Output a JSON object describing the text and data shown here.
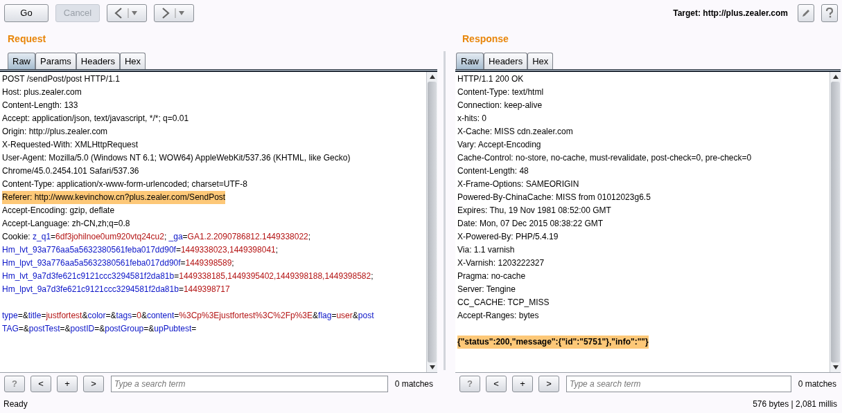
{
  "toolbar": {
    "buttons": [
      {
        "label": "Go",
        "disabled": false
      },
      {
        "label": "Cancel",
        "disabled": true
      }
    ],
    "target_label": "Target: http://plus.zealer.com"
  },
  "panes": [
    {
      "title": "Request",
      "tabs": [
        {
          "label": "Raw",
          "selected": true
        },
        {
          "label": "Params",
          "selected": false
        },
        {
          "label": "Headers",
          "selected": false
        },
        {
          "label": "Hex",
          "selected": false
        }
      ],
      "lines": [
        {
          "segments": [
            {
              "kind": "plain",
              "text": "POST /sendPost/post HTTP/1.1"
            }
          ]
        },
        {
          "segments": [
            {
              "kind": "plain",
              "text": "Host: plus.zealer.com"
            }
          ]
        },
        {
          "segments": [
            {
              "kind": "plain",
              "text": "Content-Length: 133"
            }
          ]
        },
        {
          "segments": [
            {
              "kind": "plain",
              "text": "Accept: application/json, text/javascript, */*; q=0.01"
            }
          ]
        },
        {
          "segments": [
            {
              "kind": "plain",
              "text": "Origin: http://plus.zealer.com"
            }
          ]
        },
        {
          "segments": [
            {
              "kind": "plain",
              "text": "X-Requested-With: XMLHttpRequest"
            }
          ]
        },
        {
          "segments": [
            {
              "kind": "plain",
              "text": "User-Agent: Mozilla/5.0 (Windows NT 6.1; WOW64) AppleWebKit/537.36 (KHTML, like Gecko)"
            }
          ]
        },
        {
          "segments": [
            {
              "kind": "plain",
              "text": "Chrome/45.0.2454.101 Safari/537.36"
            }
          ]
        },
        {
          "segments": [
            {
              "kind": "plain",
              "text": "Content-Type: application/x-www-form-urlencoded; charset=UTF-8"
            }
          ]
        },
        {
          "highlighted": true,
          "segments": [
            {
              "kind": "plain",
              "text": "Referer: http://www.kevinchow.cn?plus.zealer.com/SendPost"
            }
          ]
        },
        {
          "segments": [
            {
              "kind": "plain",
              "text": "Accept-Encoding: gzip, deflate"
            }
          ]
        },
        {
          "segments": [
            {
              "kind": "plain",
              "text": "Accept-Language: zh-CN,zh;q=0.8"
            }
          ]
        },
        {
          "segments": [
            {
              "kind": "plain",
              "text": "Cookie: "
            },
            {
              "kind": "name",
              "text": "z_q1"
            },
            {
              "kind": "plain",
              "text": "="
            },
            {
              "kind": "value",
              "text": "6df3johilnoe0um920vtq24cu2"
            },
            {
              "kind": "plain",
              "text": "; "
            },
            {
              "kind": "name",
              "text": "_ga"
            },
            {
              "kind": "plain",
              "text": "="
            },
            {
              "kind": "value",
              "text": "GA1.2.2090786812.1449338022"
            },
            {
              "kind": "plain",
              "text": ";"
            }
          ]
        },
        {
          "segments": [
            {
              "kind": "name",
              "text": "Hm_lvt_93a776aa5a5632380561feba017dd90f"
            },
            {
              "kind": "plain",
              "text": "="
            },
            {
              "kind": "value",
              "text": "1449338023,1449398041"
            },
            {
              "kind": "plain",
              "text": ";"
            }
          ]
        },
        {
          "segments": [
            {
              "kind": "name",
              "text": "Hm_lpvt_93a776aa5a5632380561feba017dd90f"
            },
            {
              "kind": "plain",
              "text": "="
            },
            {
              "kind": "value",
              "text": "1449398589"
            },
            {
              "kind": "plain",
              "text": ";"
            }
          ]
        },
        {
          "segments": [
            {
              "kind": "name",
              "text": "Hm_lvt_9a7d3fe621c9121ccc3294581f2da81b"
            },
            {
              "kind": "plain",
              "text": "="
            },
            {
              "kind": "value",
              "text": "1449338185,1449395402,1449398188,1449398582"
            },
            {
              "kind": "plain",
              "text": ";"
            }
          ]
        },
        {
          "segments": [
            {
              "kind": "name",
              "text": "Hm_lpvt_9a7d3fe621c9121ccc3294581f2da81b"
            },
            {
              "kind": "plain",
              "text": "="
            },
            {
              "kind": "value",
              "text": "1449398717"
            }
          ]
        },
        {
          "kind": "blank"
        },
        {
          "segments": [
            {
              "kind": "name",
              "text": "type"
            },
            {
              "kind": "plain",
              "text": "=&"
            },
            {
              "kind": "name",
              "text": "title"
            },
            {
              "kind": "plain",
              "text": "="
            },
            {
              "kind": "value",
              "text": "justfortest"
            },
            {
              "kind": "plain",
              "text": "&"
            },
            {
              "kind": "name",
              "text": "color"
            },
            {
              "kind": "plain",
              "text": "=&"
            },
            {
              "kind": "name",
              "text": "tags"
            },
            {
              "kind": "plain",
              "text": "="
            },
            {
              "kind": "value",
              "text": "0"
            },
            {
              "kind": "plain",
              "text": "&"
            },
            {
              "kind": "name",
              "text": "content"
            },
            {
              "kind": "plain",
              "text": "="
            },
            {
              "kind": "value",
              "text": "%3Cp%3Ejustfortest%3C%2Fp%3E"
            },
            {
              "kind": "plain",
              "text": "&"
            },
            {
              "kind": "name",
              "text": "flag"
            },
            {
              "kind": "plain",
              "text": "="
            },
            {
              "kind": "value",
              "text": "user"
            },
            {
              "kind": "plain",
              "text": "&"
            },
            {
              "kind": "name",
              "text": "post"
            }
          ]
        },
        {
          "segments": [
            {
              "kind": "name",
              "text": "TAG"
            },
            {
              "kind": "plain",
              "text": "=&"
            },
            {
              "kind": "name",
              "text": "postTest"
            },
            {
              "kind": "plain",
              "text": "=&"
            },
            {
              "kind": "name",
              "text": "postID"
            },
            {
              "kind": "plain",
              "text": "=&"
            },
            {
              "kind": "name",
              "text": "postGroup"
            },
            {
              "kind": "plain",
              "text": "=&"
            },
            {
              "kind": "name",
              "text": "upPubtest"
            },
            {
              "kind": "plain",
              "text": "="
            }
          ]
        }
      ],
      "search": {
        "buttons": [
          "?",
          "<",
          "+",
          ">"
        ],
        "placeholder": "Type a search term",
        "matches": "0 matches"
      }
    },
    {
      "title": "Response",
      "tabs": [
        {
          "label": "Raw",
          "selected": true
        },
        {
          "label": "Headers",
          "selected": false
        },
        {
          "label": "Hex",
          "selected": false
        }
      ],
      "lines": [
        {
          "segments": [
            {
              "kind": "plain",
              "text": "HTTP/1.1 200 OK"
            }
          ]
        },
        {
          "segments": [
            {
              "kind": "plain",
              "text": "Content-Type: text/html"
            }
          ]
        },
        {
          "segments": [
            {
              "kind": "plain",
              "text": "Connection: keep-alive"
            }
          ]
        },
        {
          "segments": [
            {
              "kind": "plain",
              "text": "x-hits: 0"
            }
          ]
        },
        {
          "segments": [
            {
              "kind": "plain",
              "text": "X-Cache: MISS cdn.zealer.com"
            }
          ]
        },
        {
          "segments": [
            {
              "kind": "plain",
              "text": "Vary: Accept-Encoding"
            }
          ]
        },
        {
          "segments": [
            {
              "kind": "plain",
              "text": "Cache-Control: no-store, no-cache, must-revalidate, post-check=0, pre-check=0"
            }
          ]
        },
        {
          "segments": [
            {
              "kind": "plain",
              "text": "Content-Length: 48"
            }
          ]
        },
        {
          "segments": [
            {
              "kind": "plain",
              "text": "X-Frame-Options: SAMEORIGIN"
            }
          ]
        },
        {
          "segments": [
            {
              "kind": "plain",
              "text": "Powered-By-ChinaCache: MISS from 01012023g6.5"
            }
          ]
        },
        {
          "segments": [
            {
              "kind": "plain",
              "text": "Expires: Thu, 19 Nov 1981 08:52:00 GMT"
            }
          ]
        },
        {
          "segments": [
            {
              "kind": "plain",
              "text": "Date: Mon, 07 Dec 2015 08:38:22 GMT"
            }
          ]
        },
        {
          "segments": [
            {
              "kind": "plain",
              "text": "X-Powered-By: PHP/5.4.19"
            }
          ]
        },
        {
          "segments": [
            {
              "kind": "plain",
              "text": "Via: 1.1 varnish"
            }
          ]
        },
        {
          "segments": [
            {
              "kind": "plain",
              "text": "X-Varnish: 1203222327"
            }
          ]
        },
        {
          "segments": [
            {
              "kind": "plain",
              "text": "Pragma: no-cache"
            }
          ]
        },
        {
          "segments": [
            {
              "kind": "plain",
              "text": "Server: Tengine"
            }
          ]
        },
        {
          "segments": [
            {
              "kind": "plain",
              "text": "CC_CACHE: TCP_MISS"
            }
          ]
        },
        {
          "segments": [
            {
              "kind": "plain",
              "text": "Accept-Ranges: bytes"
            }
          ]
        },
        {
          "kind": "blank"
        },
        {
          "highlighted": true,
          "bold": true,
          "segments": [
            {
              "kind": "plain",
              "text": "{\"status\":200,\"message\":{\"id\":\"5751\"},\"info\":\"\"}"
            }
          ]
        }
      ],
      "search": {
        "buttons": [
          "?",
          "<",
          "+",
          ">"
        ],
        "placeholder": "Type a search term",
        "matches": "0 matches"
      }
    }
  ],
  "status_bar": {
    "left": "Ready",
    "right": "576 bytes | 2,081 millis"
  }
}
